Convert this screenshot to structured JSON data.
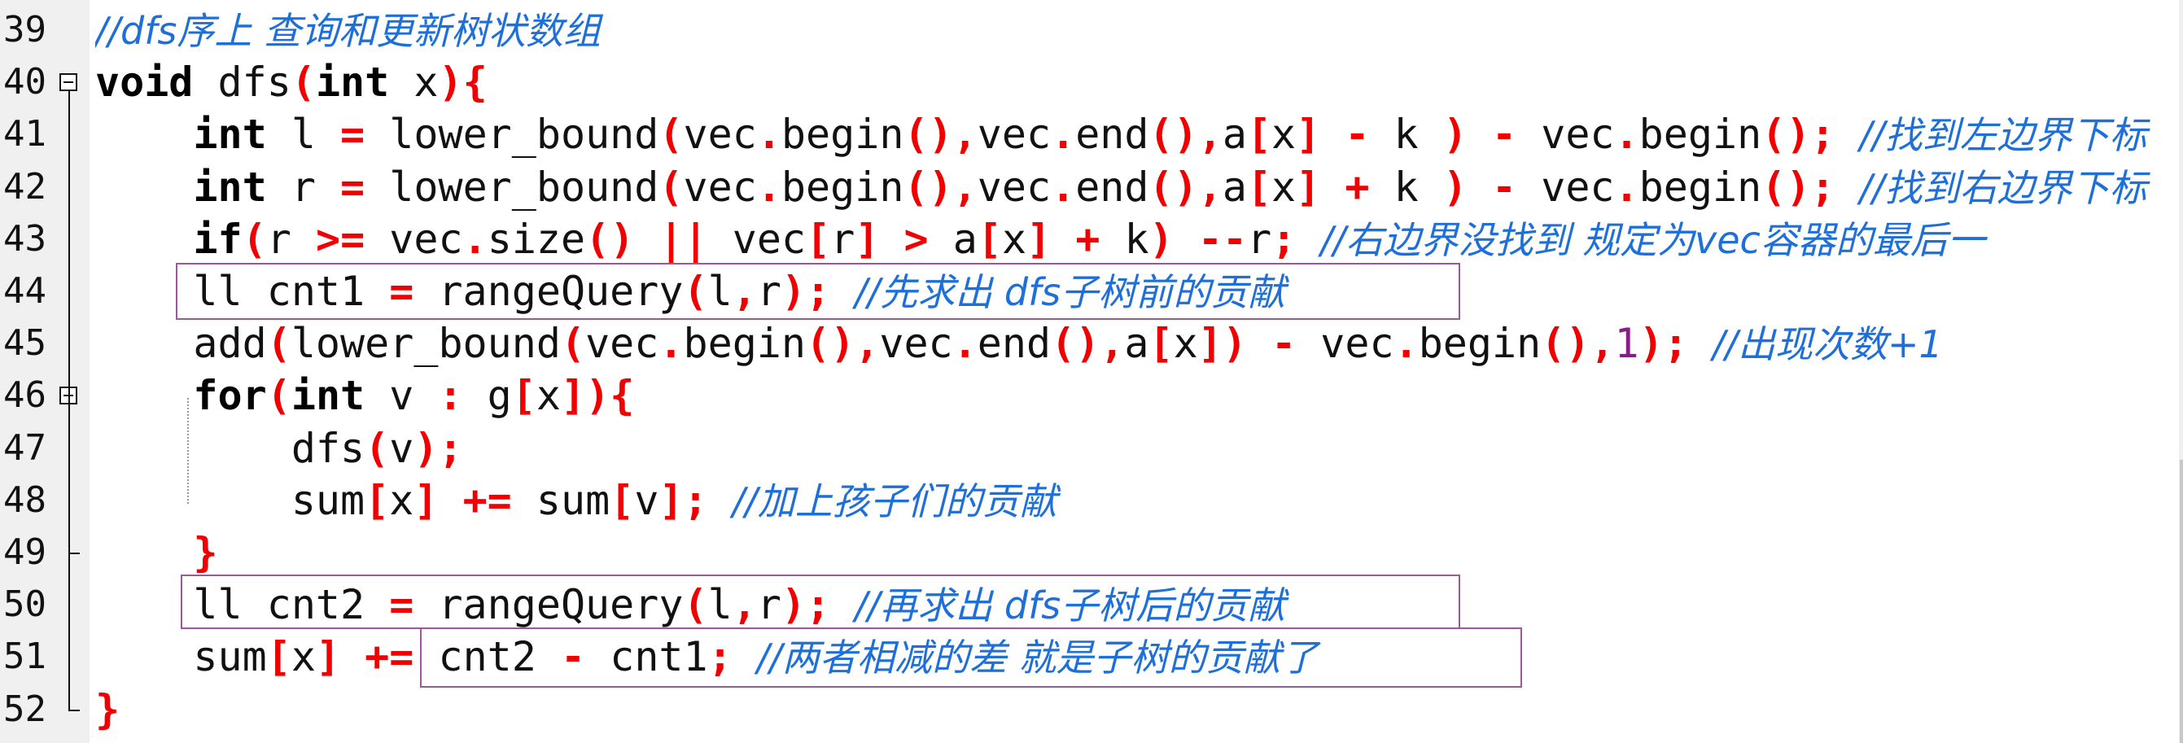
{
  "editor": {
    "lines": [
      {
        "num": "39",
        "tokens": [
          {
            "t": "cm",
            "v": "//dfs序上 查询和更新树状数组"
          }
        ]
      },
      {
        "num": "40",
        "fold": "open",
        "tokens": [
          {
            "t": "kw",
            "v": "void"
          },
          {
            "t": "id",
            "v": " dfs"
          },
          {
            "t": "op",
            "v": "("
          },
          {
            "t": "kw",
            "v": "int"
          },
          {
            "t": "id",
            "v": " x"
          },
          {
            "t": "op",
            "v": "){"
          }
        ]
      },
      {
        "num": "41",
        "tokens": [
          {
            "t": "id",
            "v": "    "
          },
          {
            "t": "kw",
            "v": "int"
          },
          {
            "t": "id",
            "v": " l "
          },
          {
            "t": "op",
            "v": "="
          },
          {
            "t": "id",
            "v": " lower_bound"
          },
          {
            "t": "op",
            "v": "("
          },
          {
            "t": "id",
            "v": "vec"
          },
          {
            "t": "op",
            "v": "."
          },
          {
            "t": "id",
            "v": "begin"
          },
          {
            "t": "op",
            "v": "()"
          },
          {
            "t": "op",
            "v": ","
          },
          {
            "t": "id",
            "v": "vec"
          },
          {
            "t": "op",
            "v": "."
          },
          {
            "t": "id",
            "v": "end"
          },
          {
            "t": "op",
            "v": "()"
          },
          {
            "t": "op",
            "v": ","
          },
          {
            "t": "id",
            "v": "a"
          },
          {
            "t": "op",
            "v": "["
          },
          {
            "t": "id",
            "v": "x"
          },
          {
            "t": "op",
            "v": "]"
          },
          {
            "t": "id",
            "v": " "
          },
          {
            "t": "op",
            "v": "-"
          },
          {
            "t": "id",
            "v": " k "
          },
          {
            "t": "op",
            "v": ")"
          },
          {
            "t": "id",
            "v": " "
          },
          {
            "t": "op",
            "v": "-"
          },
          {
            "t": "id",
            "v": " vec"
          },
          {
            "t": "op",
            "v": "."
          },
          {
            "t": "id",
            "v": "begin"
          },
          {
            "t": "op",
            "v": "();"
          },
          {
            "t": "id",
            "v": " "
          },
          {
            "t": "cm",
            "v": "//找到左边界下标"
          }
        ]
      },
      {
        "num": "42",
        "tokens": [
          {
            "t": "id",
            "v": "    "
          },
          {
            "t": "kw",
            "v": "int"
          },
          {
            "t": "id",
            "v": " r "
          },
          {
            "t": "op",
            "v": "="
          },
          {
            "t": "id",
            "v": " lower_bound"
          },
          {
            "t": "op",
            "v": "("
          },
          {
            "t": "id",
            "v": "vec"
          },
          {
            "t": "op",
            "v": "."
          },
          {
            "t": "id",
            "v": "begin"
          },
          {
            "t": "op",
            "v": "()"
          },
          {
            "t": "op",
            "v": ","
          },
          {
            "t": "id",
            "v": "vec"
          },
          {
            "t": "op",
            "v": "."
          },
          {
            "t": "id",
            "v": "end"
          },
          {
            "t": "op",
            "v": "()"
          },
          {
            "t": "op",
            "v": ","
          },
          {
            "t": "id",
            "v": "a"
          },
          {
            "t": "op",
            "v": "["
          },
          {
            "t": "id",
            "v": "x"
          },
          {
            "t": "op",
            "v": "]"
          },
          {
            "t": "id",
            "v": " "
          },
          {
            "t": "op",
            "v": "+"
          },
          {
            "t": "id",
            "v": " k "
          },
          {
            "t": "op",
            "v": ")"
          },
          {
            "t": "id",
            "v": " "
          },
          {
            "t": "op",
            "v": "-"
          },
          {
            "t": "id",
            "v": " vec"
          },
          {
            "t": "op",
            "v": "."
          },
          {
            "t": "id",
            "v": "begin"
          },
          {
            "t": "op",
            "v": "();"
          },
          {
            "t": "id",
            "v": " "
          },
          {
            "t": "cm",
            "v": "//找到右边界下标"
          }
        ]
      },
      {
        "num": "43",
        "tokens": [
          {
            "t": "id",
            "v": "    "
          },
          {
            "t": "kw",
            "v": "if"
          },
          {
            "t": "op",
            "v": "("
          },
          {
            "t": "id",
            "v": "r "
          },
          {
            "t": "op",
            "v": ">="
          },
          {
            "t": "id",
            "v": " vec"
          },
          {
            "t": "op",
            "v": "."
          },
          {
            "t": "id",
            "v": "size"
          },
          {
            "t": "op",
            "v": "()"
          },
          {
            "t": "id",
            "v": " "
          },
          {
            "t": "op",
            "v": "||"
          },
          {
            "t": "id",
            "v": " vec"
          },
          {
            "t": "op",
            "v": "["
          },
          {
            "t": "id",
            "v": "r"
          },
          {
            "t": "op",
            "v": "]"
          },
          {
            "t": "id",
            "v": " "
          },
          {
            "t": "op",
            "v": ">"
          },
          {
            "t": "id",
            "v": " a"
          },
          {
            "t": "op",
            "v": "["
          },
          {
            "t": "id",
            "v": "x"
          },
          {
            "t": "op",
            "v": "]"
          },
          {
            "t": "id",
            "v": " "
          },
          {
            "t": "op",
            "v": "+"
          },
          {
            "t": "id",
            "v": " k"
          },
          {
            "t": "op",
            "v": ")"
          },
          {
            "t": "id",
            "v": " "
          },
          {
            "t": "op",
            "v": "--"
          },
          {
            "t": "id",
            "v": "r"
          },
          {
            "t": "op",
            "v": ";"
          },
          {
            "t": "id",
            "v": " "
          },
          {
            "t": "cm",
            "v": "//右边界没找到 规定为vec容器的最后一"
          }
        ]
      },
      {
        "num": "44",
        "tokens": [
          {
            "t": "id",
            "v": "    ll cnt1 "
          },
          {
            "t": "op",
            "v": "="
          },
          {
            "t": "id",
            "v": " rangeQuery"
          },
          {
            "t": "op",
            "v": "("
          },
          {
            "t": "id",
            "v": "l"
          },
          {
            "t": "op",
            "v": ","
          },
          {
            "t": "id",
            "v": "r"
          },
          {
            "t": "op",
            "v": ");"
          },
          {
            "t": "id",
            "v": " "
          },
          {
            "t": "cm",
            "v": "//先求出 dfs子树前的贡献"
          }
        ]
      },
      {
        "num": "45",
        "tokens": [
          {
            "t": "id",
            "v": "    add"
          },
          {
            "t": "op",
            "v": "("
          },
          {
            "t": "id",
            "v": "lower_bound"
          },
          {
            "t": "op",
            "v": "("
          },
          {
            "t": "id",
            "v": "vec"
          },
          {
            "t": "op",
            "v": "."
          },
          {
            "t": "id",
            "v": "begin"
          },
          {
            "t": "op",
            "v": "()"
          },
          {
            "t": "op",
            "v": ","
          },
          {
            "t": "id",
            "v": "vec"
          },
          {
            "t": "op",
            "v": "."
          },
          {
            "t": "id",
            "v": "end"
          },
          {
            "t": "op",
            "v": "()"
          },
          {
            "t": "op",
            "v": ","
          },
          {
            "t": "id",
            "v": "a"
          },
          {
            "t": "op",
            "v": "["
          },
          {
            "t": "id",
            "v": "x"
          },
          {
            "t": "op",
            "v": "])"
          },
          {
            "t": "id",
            "v": " "
          },
          {
            "t": "op",
            "v": "-"
          },
          {
            "t": "id",
            "v": " vec"
          },
          {
            "t": "op",
            "v": "."
          },
          {
            "t": "id",
            "v": "begin"
          },
          {
            "t": "op",
            "v": "()"
          },
          {
            "t": "op",
            "v": ","
          },
          {
            "t": "num",
            "v": "1"
          },
          {
            "t": "op",
            "v": ");"
          },
          {
            "t": "id",
            "v": " "
          },
          {
            "t": "cm",
            "v": "//出现次数+1"
          }
        ]
      },
      {
        "num": "46",
        "fold": "open",
        "tokens": [
          {
            "t": "id",
            "v": "    "
          },
          {
            "t": "kw",
            "v": "for"
          },
          {
            "t": "op",
            "v": "("
          },
          {
            "t": "kw",
            "v": "int"
          },
          {
            "t": "id",
            "v": " v "
          },
          {
            "t": "op",
            "v": ":"
          },
          {
            "t": "id",
            "v": " g"
          },
          {
            "t": "op",
            "v": "["
          },
          {
            "t": "id",
            "v": "x"
          },
          {
            "t": "op",
            "v": "]){"
          }
        ]
      },
      {
        "num": "47",
        "tokens": [
          {
            "t": "id",
            "v": "        dfs"
          },
          {
            "t": "op",
            "v": "("
          },
          {
            "t": "id",
            "v": "v"
          },
          {
            "t": "op",
            "v": ");"
          }
        ]
      },
      {
        "num": "48",
        "tokens": [
          {
            "t": "id",
            "v": "        sum"
          },
          {
            "t": "op",
            "v": "["
          },
          {
            "t": "id",
            "v": "x"
          },
          {
            "t": "op",
            "v": "]"
          },
          {
            "t": "id",
            "v": " "
          },
          {
            "t": "op",
            "v": "+="
          },
          {
            "t": "id",
            "v": " sum"
          },
          {
            "t": "op",
            "v": "["
          },
          {
            "t": "id",
            "v": "v"
          },
          {
            "t": "op",
            "v": "];"
          },
          {
            "t": "id",
            "v": " "
          },
          {
            "t": "cm",
            "v": "//加上孩子们的贡献"
          }
        ]
      },
      {
        "num": "49",
        "fold": "tick",
        "tokens": [
          {
            "t": "id",
            "v": "    "
          },
          {
            "t": "op",
            "v": "}"
          }
        ]
      },
      {
        "num": "50",
        "tokens": [
          {
            "t": "id",
            "v": "    ll cnt2 "
          },
          {
            "t": "op",
            "v": "="
          },
          {
            "t": "id",
            "v": " rangeQuery"
          },
          {
            "t": "op",
            "v": "("
          },
          {
            "t": "id",
            "v": "l"
          },
          {
            "t": "op",
            "v": ","
          },
          {
            "t": "id",
            "v": "r"
          },
          {
            "t": "op",
            "v": ");"
          },
          {
            "t": "id",
            "v": " "
          },
          {
            "t": "cm",
            "v": "//再求出 dfs子树后的贡献"
          }
        ]
      },
      {
        "num": "51",
        "tokens": [
          {
            "t": "id",
            "v": "    sum"
          },
          {
            "t": "op",
            "v": "["
          },
          {
            "t": "id",
            "v": "x"
          },
          {
            "t": "op",
            "v": "]"
          },
          {
            "t": "id",
            "v": " "
          },
          {
            "t": "op",
            "v": "+="
          },
          {
            "t": "id",
            "v": " cnt2 "
          },
          {
            "t": "op",
            "v": "-"
          },
          {
            "t": "id",
            "v": " cnt1"
          },
          {
            "t": "op",
            "v": ";"
          },
          {
            "t": "id",
            "v": " "
          },
          {
            "t": "cm",
            "v": "//两者相减的差 就是子树的贡献了"
          }
        ]
      },
      {
        "num": "52",
        "fold": "end",
        "tokens": [
          {
            "t": "op",
            "v": "}"
          }
        ]
      }
    ],
    "highlights": [
      {
        "label": "cnt1-range-query",
        "line": "44"
      },
      {
        "label": "cnt2-range-query",
        "line": "50"
      },
      {
        "label": "contribution-difference",
        "line": "51"
      }
    ],
    "colors": {
      "keyword": "#000000",
      "operator": "#f00000",
      "number": "#8b1a8b",
      "comment": "#1e6fd9",
      "highlight_border": "#9a5a9a",
      "gutter_bg": "#f0f0f0"
    }
  }
}
